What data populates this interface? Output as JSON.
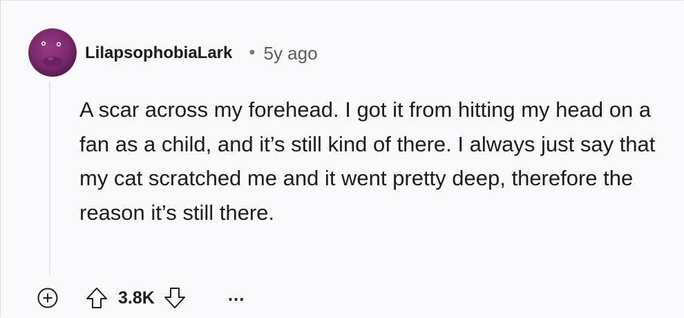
{
  "comment": {
    "author": "LilapsophobiaLark",
    "separator": "•",
    "age": "5y ago",
    "body": "A scar across my forehead. I got it from hitting my head on a fan as a child, and it’s still kind of there. I always just say that my cat scratched me and it went pretty deep, therefore the reason it’s still there.",
    "score": "3.8K",
    "more_label": "..."
  },
  "icons": {
    "avatar": "purple-character-avatar",
    "expand": "plus-circle-icon",
    "upvote": "arrow-up-icon",
    "downvote": "arrow-down-icon",
    "more": "ellipsis-icon"
  },
  "colors": {
    "background": "#f9f9fb",
    "avatar_purple": "#7a2a6b",
    "text": "#1c1c1c",
    "muted": "#5c5c5c"
  }
}
